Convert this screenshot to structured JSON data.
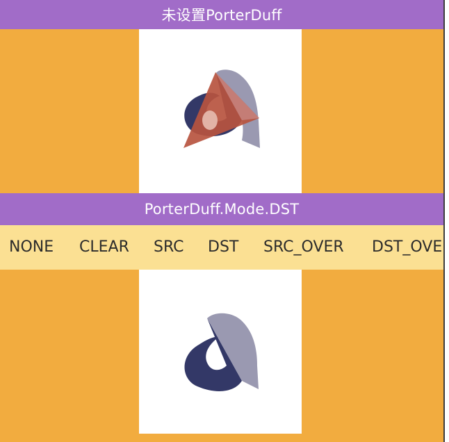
{
  "top_panel": {
    "title": "未设置PorterDuff",
    "shapes": [
      "destination-shape",
      "source-triangle"
    ]
  },
  "mode_panel": {
    "title": "PorterDuff.Mode.DST"
  },
  "mode_tabs": [
    {
      "label": "NONE"
    },
    {
      "label": "CLEAR"
    },
    {
      "label": "SRC"
    },
    {
      "label": "DST"
    },
    {
      "label": "SRC_OVER"
    },
    {
      "label": "DST_OVER"
    }
  ],
  "bottom_panel": {
    "shapes": [
      "destination-shape"
    ]
  },
  "colors": {
    "title_bar": "#a16cc8",
    "background": "#f2ac3f",
    "tab_bar": "#fbe093",
    "canvas": "#ffffff",
    "dest_dark": "#333867",
    "dest_light": "#9a99b1",
    "source_red": "#b7543f"
  }
}
